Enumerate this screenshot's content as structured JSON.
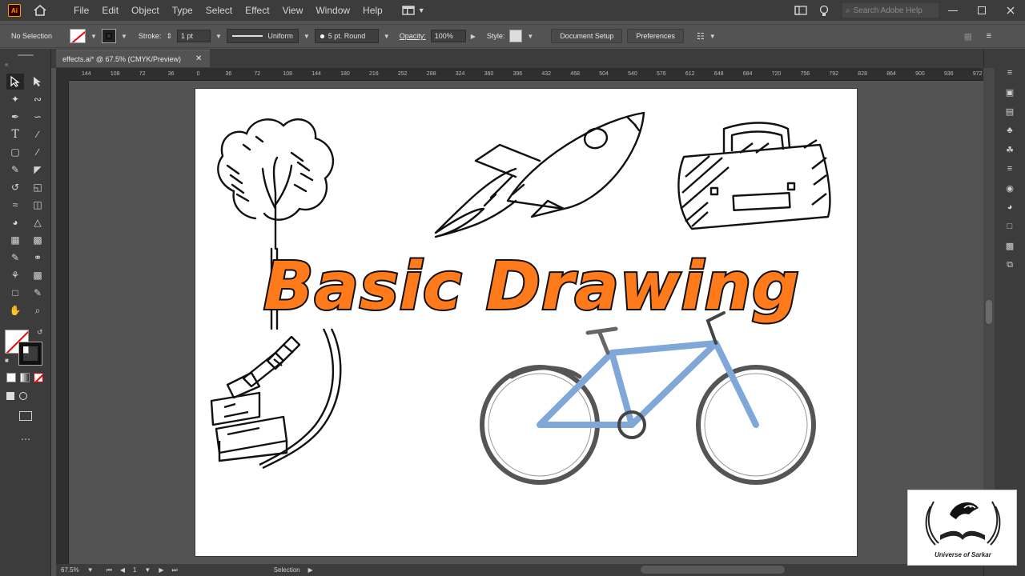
{
  "app": {
    "logo": "Ai",
    "menu": [
      "File",
      "Edit",
      "Object",
      "Type",
      "Select",
      "Effect",
      "View",
      "Window",
      "Help"
    ],
    "search_placeholder": "Search Adobe Help"
  },
  "controlbar": {
    "selection": "No Selection",
    "stroke_label": "Stroke:",
    "stroke_weight": "1 pt",
    "profile": "Uniform",
    "brush": "5 pt. Round",
    "opacity_label": "Opacity:",
    "opacity_value": "100%",
    "style_label": "Style:",
    "document_setup": "Document Setup",
    "preferences": "Preferences"
  },
  "document": {
    "tab_title": "effects.ai* @ 67.5% (CMYK/Preview)"
  },
  "ruler_ticks": [
    "144",
    "108",
    "72",
    "36",
    "0",
    "36",
    "72",
    "108",
    "144",
    "180",
    "216",
    "252",
    "288",
    "324",
    "360",
    "396",
    "432",
    "468",
    "504",
    "540",
    "576",
    "612",
    "648",
    "684",
    "720",
    "756",
    "792",
    "828",
    "864",
    "900",
    "936",
    "972"
  ],
  "artboard": {
    "title": "Basic Drawing"
  },
  "statusbar": {
    "zoom": "67.5%",
    "artboard_num": "1",
    "tool": "Selection"
  },
  "watermark": {
    "text": "Universe of Sarkar"
  },
  "colors": {
    "accent_orange": "#ff7a1a",
    "bike_blue": "#7fa7d8"
  }
}
